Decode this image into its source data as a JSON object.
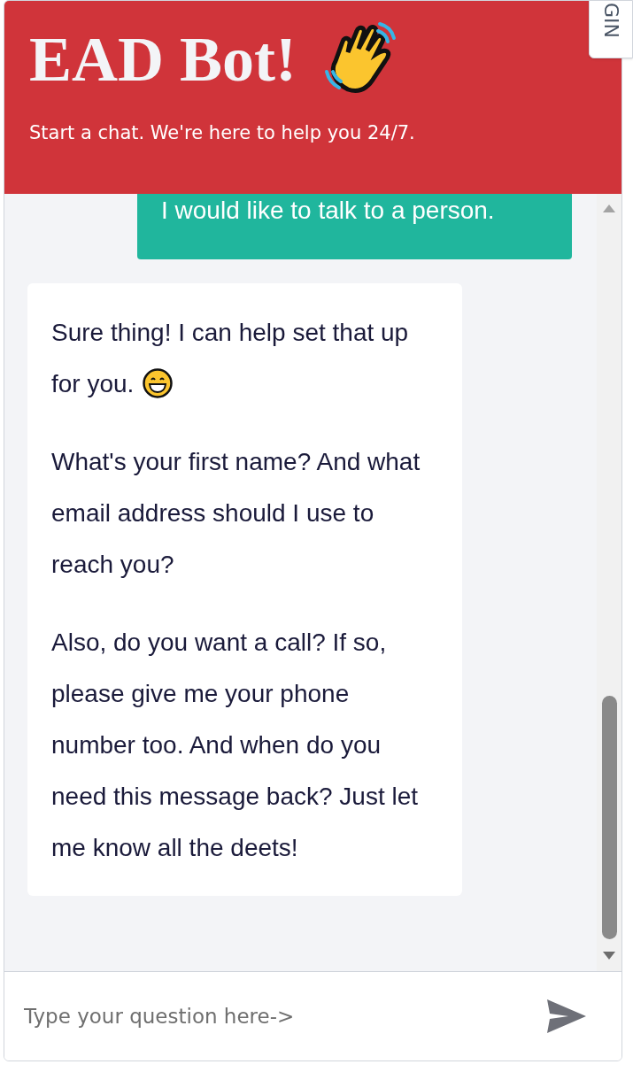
{
  "side_tab": {
    "label": "GIN"
  },
  "header": {
    "title": "EAD Bot!",
    "subtitle": "Start a chat. We're here to help you 24/7."
  },
  "messages": [
    {
      "kind": "user",
      "paragraphs": [
        {
          "text": "I would like to talk to a person.",
          "has_icon": false
        }
      ]
    },
    {
      "kind": "bot",
      "paragraphs": [
        {
          "text": "Sure thing! I can help set that up for you.",
          "has_icon": true
        },
        {
          "text": "What's your first name? And what email address should I use to reach you?",
          "has_icon": false
        },
        {
          "text": "Also, do you want a call? If so, please give me your phone number too. And when do you need this message back? Just let me know all the deets!",
          "has_icon": false
        }
      ]
    }
  ],
  "input": {
    "placeholder": "Type your question here->"
  }
}
